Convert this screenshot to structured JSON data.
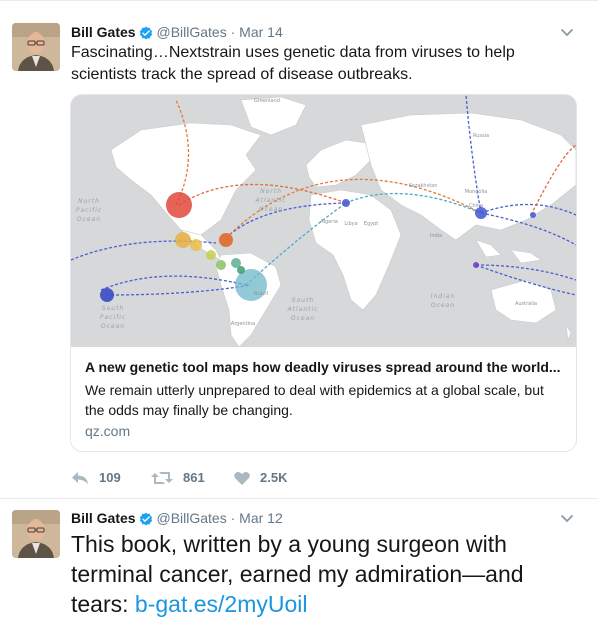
{
  "tweets": [
    {
      "name": "Bill Gates",
      "handle": "@BillGates",
      "separator": "·",
      "date": "Mar 14",
      "text": "Fascinating…Nextstrain uses genetic data from viruses to help scientists track the spread of disease outbreaks.",
      "card": {
        "title": "A new genetic tool maps how deadly viruses spread around the world...",
        "description": "We remain utterly unprepared to deal with epidemics at a global scale, but the odds may finally be changing.",
        "domain": "qz.com",
        "map_labels": {
          "north_pacific": [
            "North",
            "Pacific",
            "Ocean"
          ],
          "north_atlantic": [
            "North",
            "Atlantic",
            "Ocean"
          ],
          "south_pacific": [
            "South",
            "Pacific",
            "Ocean"
          ],
          "south_atlantic": [
            "South",
            "Atlantic",
            "Ocean"
          ],
          "indian": [
            "Indian",
            "Ocean"
          ],
          "greenland": "Greenland",
          "russia": "Russia",
          "kazakhstan": "Kazakhstan",
          "mongolia": "Mongolia",
          "china": "China",
          "india": "India",
          "algeria": "Algeria",
          "libya": "Libya",
          "egypt": "Egypt",
          "australia": "Australia",
          "brazil": "Brazil",
          "argentina": "Argentina"
        }
      },
      "actions": {
        "reply": "109",
        "retweet": "861",
        "like": "2.5K"
      }
    },
    {
      "name": "Bill Gates",
      "handle": "@BillGates",
      "separator": "·",
      "date": "Mar 12",
      "text": "This book, written by a young surgeon with terminal cancer, earned my admiration—and tears: ",
      "link": "b-gat.es/2myUoil"
    }
  ],
  "colors": {
    "verified": "#1da1f2",
    "link": "#1b95e0",
    "secondary_text": "#657786",
    "map_land": "#ffffff",
    "map_water": "#d6d8d9"
  },
  "icons": [
    "verified-badge-icon",
    "caret-down-icon",
    "reply-icon",
    "retweet-icon",
    "heart-icon"
  ]
}
